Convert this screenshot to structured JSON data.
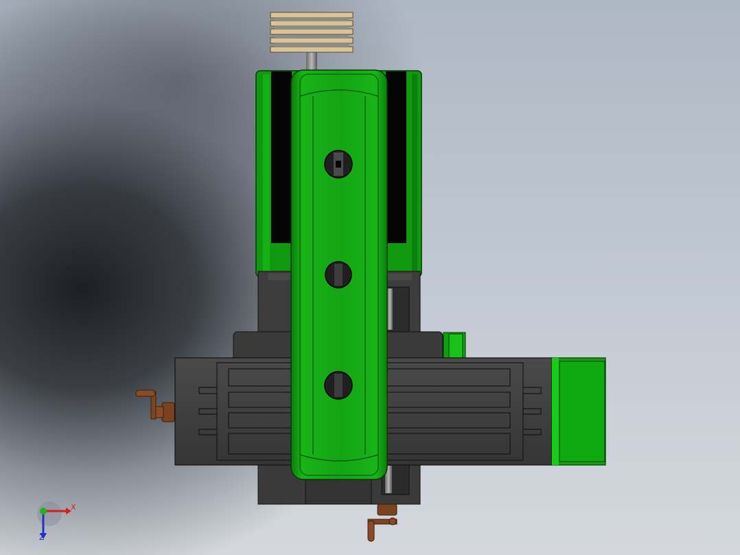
{
  "viewport": {
    "background_dark": "#25282e",
    "background_light": "#d4d8dd"
  },
  "model": {
    "colors": {
      "green_main": "#12a012",
      "green_bright": "#18c018",
      "green_dark": "#0a700a",
      "steel_dark": "#3a3a3a",
      "steel_mid": "#444444",
      "black": "#050505",
      "handle_bronze": "#8a4b24",
      "pulley_tan": "#d9c49a"
    },
    "parts": [
      "pulley-stack",
      "column-housing",
      "ram-head",
      "spindle-holes",
      "work-table",
      "table-slots",
      "crank-handle-left",
      "crank-handle-bottom",
      "side-green-block"
    ]
  },
  "triad": {
    "x_label": "X",
    "z_label": "Z",
    "x_color": "#d21f1f",
    "y_color": "#1fb31f",
    "z_color": "#2430c8"
  }
}
